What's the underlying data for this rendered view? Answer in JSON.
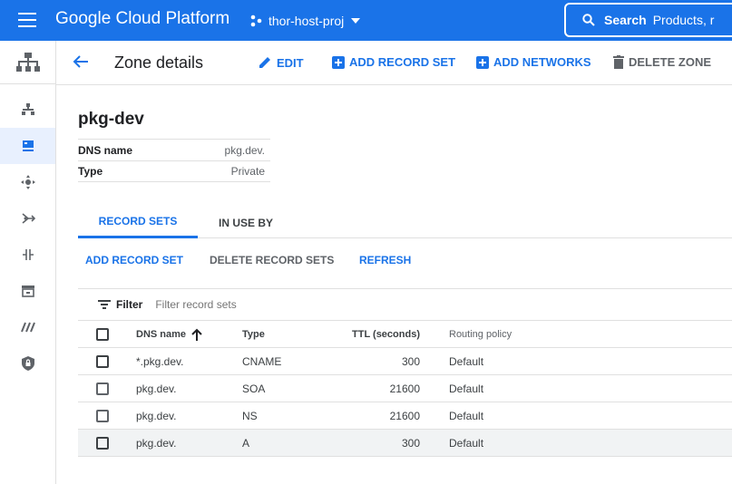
{
  "topbar": {
    "app_title": "Google Cloud Platform",
    "project": "thor-host-proj",
    "search_label": "Search",
    "search_placeholder": "Products, r"
  },
  "header": {
    "title": "Zone details",
    "actions": {
      "edit": "EDIT",
      "add_record_set": "ADD RECORD SET",
      "add_networks": "ADD NETWORKS",
      "delete_zone": "DELETE ZONE"
    }
  },
  "zone": {
    "name": "pkg-dev",
    "details": [
      {
        "key": "DNS name",
        "value": "pkg.dev."
      },
      {
        "key": "Type",
        "value": "Private"
      }
    ]
  },
  "tabs": [
    "RECORD SETS",
    "IN USE BY"
  ],
  "toolbar": {
    "add": "ADD RECORD SET",
    "delete": "DELETE RECORD SETS",
    "refresh": "REFRESH"
  },
  "filter": {
    "label": "Filter",
    "placeholder": "Filter record sets"
  },
  "table": {
    "columns": [
      "DNS name",
      "Type",
      "TTL (seconds)",
      "Routing policy"
    ],
    "rows": [
      {
        "dns": "*.pkg.dev.",
        "type": "CNAME",
        "ttl": "300",
        "policy": "Default"
      },
      {
        "dns": "pkg.dev.",
        "type": "SOA",
        "ttl": "21600",
        "policy": "Default"
      },
      {
        "dns": "pkg.dev.",
        "type": "NS",
        "ttl": "21600",
        "policy": "Default"
      },
      {
        "dns": "pkg.dev.",
        "type": "A",
        "ttl": "300",
        "policy": "Default"
      }
    ]
  },
  "colors": {
    "accent": "#1a73e8",
    "topbar": "#1a73e8"
  }
}
